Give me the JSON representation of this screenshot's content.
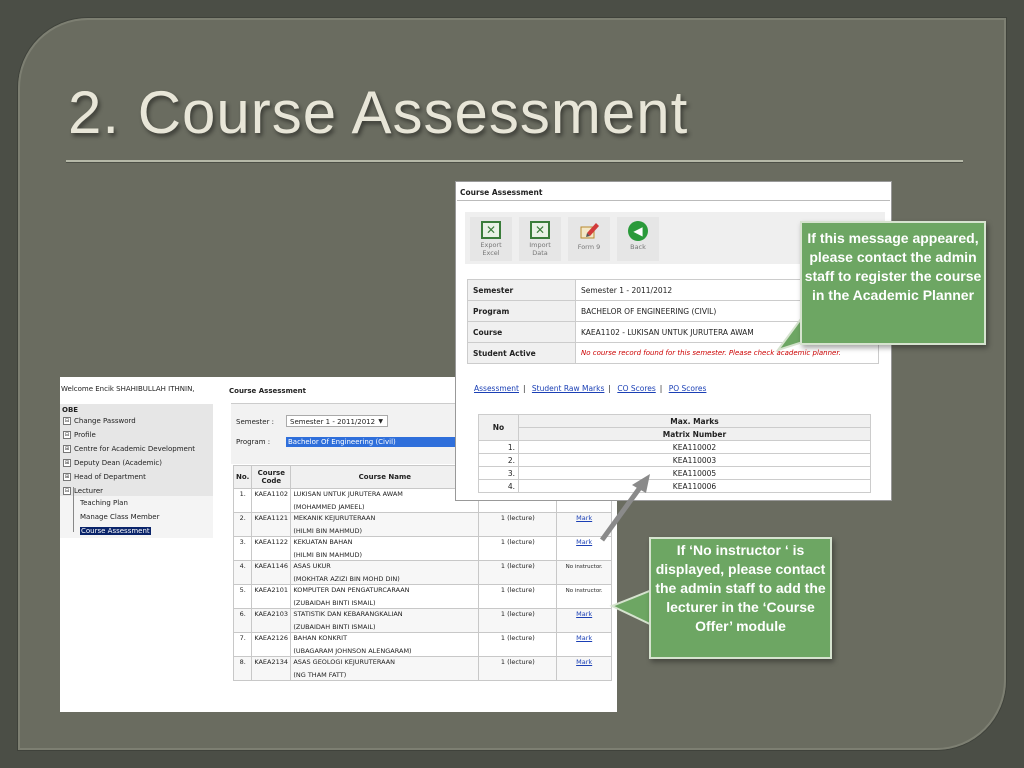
{
  "slide": {
    "title": "2. Course Assessment"
  },
  "left_shot": {
    "welcome": "Welcome Encik SHAHIBULLAH ITHNIN,",
    "nav_title": "OBE",
    "nav_items": [
      {
        "toggle": "⊟",
        "label": "Change Password"
      },
      {
        "toggle": "⊟",
        "label": "Profile"
      },
      {
        "toggle": "⊞",
        "label": "Centre for Academic Development"
      },
      {
        "toggle": "⊞",
        "label": "Deputy Dean (Academic)"
      },
      {
        "toggle": "⊞",
        "label": "Head of Department"
      },
      {
        "toggle": "⊟",
        "label": "Lecturer"
      }
    ],
    "sub_items": [
      "Teaching Plan",
      "Manage Class Member",
      "Course Assessment"
    ],
    "panel_title": "Course Assessment",
    "semester_label": "Semester  :",
    "semester_value": "Semester 1 - 2011/2012",
    "program_label": "Program   :",
    "program_value": "Bachelor Of Engineering (Civil)",
    "table_headers": [
      "No.",
      "Course Code",
      "Course Name",
      "",
      ""
    ],
    "rows": [
      {
        "no": "1.",
        "code": "KAEA1102",
        "name": "LUKISAN UNTUK JURUTERA AWAM",
        "lecturer": "(MOHAMMED JAMEEL)",
        "inst": "",
        "action": ""
      },
      {
        "no": "2.",
        "code": "KAEA1121",
        "name": "MEKANIK KEJURUTERAAN",
        "lecturer": "(HILMI BIN MAHMUD)",
        "inst": "1 (lecture)",
        "action": "Mark"
      },
      {
        "no": "3.",
        "code": "KAEA1122",
        "name": "KEKUATAN BAHAN",
        "lecturer": "(HILMI BIN MAHMUD)",
        "inst": "1 (lecture)",
        "action": "Mark"
      },
      {
        "no": "4.",
        "code": "KAEA1146",
        "name": "ASAS UKUR",
        "lecturer": "(MOKHTAR AZIZI BIN MOHD DIN)",
        "inst": "1 (lecture)",
        "action": "No instructor."
      },
      {
        "no": "5.",
        "code": "KAEA2101",
        "name": "KOMPUTER DAN PENGATURCARAAN",
        "lecturer": "(ZUBAIDAH BINTI ISMAIL)",
        "inst": "1 (lecture)",
        "action": "No instructor."
      },
      {
        "no": "6.",
        "code": "KAEA2103",
        "name": "STATISTIK DAN KEBARANGKALIAN",
        "lecturer": "(ZUBAIDAH BINTI ISMAIL)",
        "inst": "1 (lecture)",
        "action": "Mark"
      },
      {
        "no": "7.",
        "code": "KAEA2126",
        "name": "BAHAN KONKRIT",
        "lecturer": "(UBAGARAM JOHNSON ALENGARAM)",
        "inst": "1 (lecture)",
        "action": "Mark"
      },
      {
        "no": "8.",
        "code": "KAEA2134",
        "name": "ASAS GEOLOGI KEJURUTERAAN",
        "lecturer": "(NG THAM FATT)",
        "inst": "1 (lecture)",
        "action": "Mark"
      }
    ]
  },
  "right_shot": {
    "title": "Course Assessment",
    "toolbar": {
      "export_line1": "Export",
      "export_line2": "Excel",
      "import_line1": "Import",
      "import_line2": "Data",
      "form9": "Form 9",
      "back": "Back"
    },
    "info": {
      "semester_key": "Semester",
      "semester_val": "Semester 1 - 2011/2012",
      "program_key": "Program",
      "program_val": "BACHELOR OF ENGINEERING (CIVIL)",
      "course_key": "Course",
      "course_val": "KAEA1102 - LUKISAN UNTUK JURUTERA AWAM",
      "student_key": "Student Active",
      "student_val": "No course record found for this semester. Please check academic planner."
    },
    "links": [
      "Assessment",
      "Student Raw Marks",
      "CO Scores",
      "PO Scores"
    ],
    "marks": {
      "no_header": "No",
      "max_header": "Max. Marks",
      "matrix_header": "Matrix Number",
      "rows": [
        {
          "no": "1.",
          "matrix": "KEA110002"
        },
        {
          "no": "2.",
          "matrix": "KEA110003"
        },
        {
          "no": "3.",
          "matrix": "KEA110005"
        },
        {
          "no": "4.",
          "matrix": "KEA110006"
        }
      ]
    }
  },
  "callouts": {
    "top": "If this message appeared, please contact the admin staff to register the course in the Academic Planner",
    "bottom": "If ‘No instructor ‘ is displayed, please contact the admin staff to add the lecturer in the ‘Course Offer’ module"
  },
  "colors": {
    "background": "#4b4e46",
    "frame": "#6a6c60",
    "callout": "#6da663",
    "error_text": "#cc0000",
    "link": "#1a3fb5"
  }
}
